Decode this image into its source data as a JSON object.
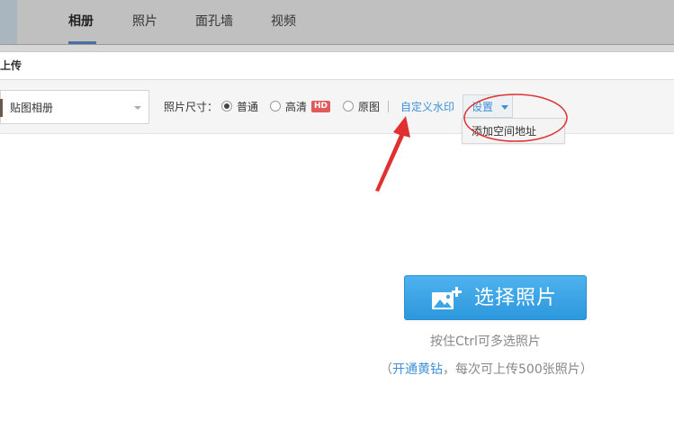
{
  "nav": {
    "tabs": [
      {
        "label": "相册",
        "active": true
      },
      {
        "label": "照片",
        "active": false
      },
      {
        "label": "面孔墙",
        "active": false
      },
      {
        "label": "视频",
        "active": false
      }
    ]
  },
  "dialog": {
    "title": "上传"
  },
  "toolbar": {
    "album_select_value": "贴图相册",
    "photo_size_label": "照片尺寸：",
    "size_options": [
      {
        "label": "普通",
        "checked": true
      },
      {
        "label": "高清",
        "checked": false,
        "badge": "HD"
      },
      {
        "label": "原图",
        "checked": false
      }
    ],
    "divider": "|",
    "custom_watermark_link": "自定义水印",
    "settings_label": "设置",
    "settings_menu": [
      "添加空间地址"
    ]
  },
  "upload": {
    "choose_button_label": "选择照片",
    "hint_multi_select": "按住Ctrl可多选照片",
    "hint_open_paren": "（",
    "hint_vip_link": "开通黄钻",
    "hint_vip_rest": "，每次可上传500张照片）"
  },
  "colors": {
    "accent_blue": "#3f8fd6",
    "button_blue": "#3aa6e8",
    "annotation_red": "#e03030",
    "hd_badge_red": "#e05a5a"
  },
  "icons": [
    "add-photo-icon",
    "chevron-down-icon"
  ]
}
